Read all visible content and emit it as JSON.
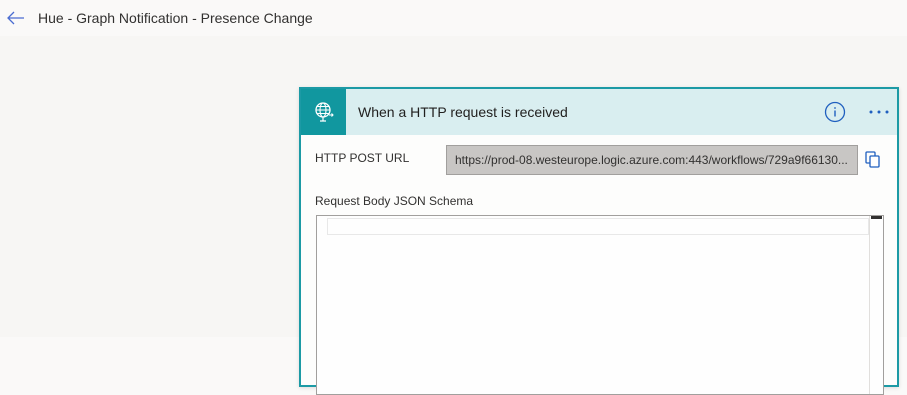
{
  "header": {
    "title": "Hue - Graph Notification - Presence Change",
    "back_icon": "arrow-left-icon"
  },
  "trigger_card": {
    "title": "When a HTTP request is received",
    "icon": "globe-request-icon",
    "accent_color": "#11979f",
    "header_bg": "#d9eef0",
    "info_icon": "info-icon",
    "more_icon": "more-options-icon",
    "http_post_url_label": "HTTP POST URL",
    "http_post_url_value": "https://prod-08.westeurope.logic.azure.com:443/workflows/729a9f66130...",
    "copy_icon": "copy-icon",
    "schema_label": "Request Body JSON Schema",
    "schema_value": ""
  }
}
